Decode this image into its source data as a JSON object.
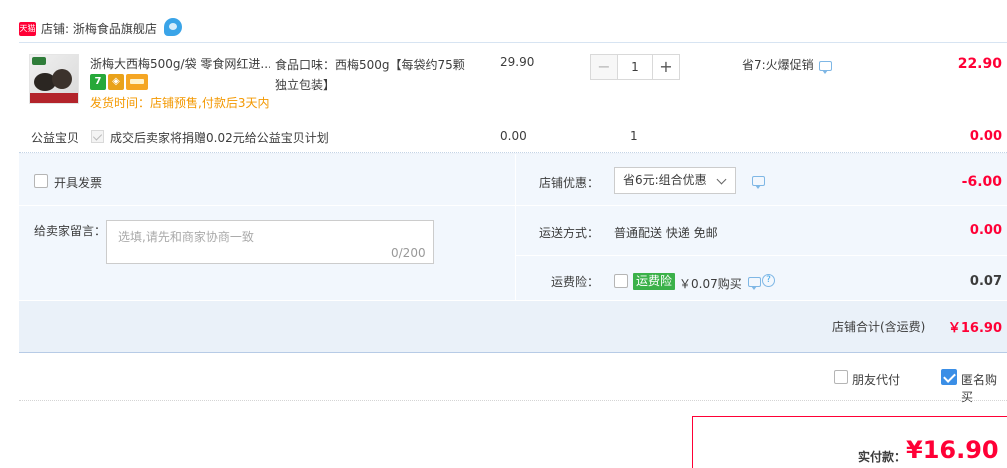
{
  "shop": {
    "badge": "天猫",
    "name": "店铺: 浙梅食品旗舰店"
  },
  "item": {
    "title": "浙梅大西梅500g/袋 零食网红进...",
    "ship_time": "发货时间：店铺预售,付款后3天内",
    "flavor": "食品口味：西梅500g【每袋约75颗独立包装】",
    "unit_price": "29.90",
    "qty": "1",
    "qty_minus": "−",
    "qty_plus": "+",
    "promo": "省7:火爆促销",
    "total": "22.90",
    "service_seven": "7"
  },
  "charity": {
    "label": "公益宝贝",
    "desc": "成交后卖家将捐赠0.02元给公益宝贝计划",
    "price": "0.00",
    "qty": "1",
    "total": "0.00"
  },
  "invoice": {
    "label": "开具发票"
  },
  "memo": {
    "label": "给卖家留言：",
    "placeholder": "选填,请先和商家协商一致",
    "count": "0/200"
  },
  "shop_discount": {
    "label": "店铺优惠：",
    "selected": "省6元:组合优惠",
    "amount": "-6.00"
  },
  "shipping": {
    "label": "运送方式：",
    "value": "普通配送 快递 免邮",
    "amount": "0.00"
  },
  "insurance": {
    "label": "运费险：",
    "badge": "运费险",
    "price": "￥0.07购买",
    "help": "?",
    "amount": "0.07"
  },
  "shop_total": {
    "label": "店铺合计(含运费)",
    "amount": "￥16.90"
  },
  "friend_pay": {
    "label": "朋友代付"
  },
  "anonymous": {
    "label": "匿名购买"
  },
  "pay": {
    "label": "实付款：",
    "amount": "¥16.90"
  },
  "colors": {
    "accent_red": "#ff0036",
    "panel_blue": "#f2f7fd",
    "checkbox_blue": "#3a8ee6",
    "insurance_green": "#3bb149",
    "ship_time_orange": "#f39800"
  }
}
